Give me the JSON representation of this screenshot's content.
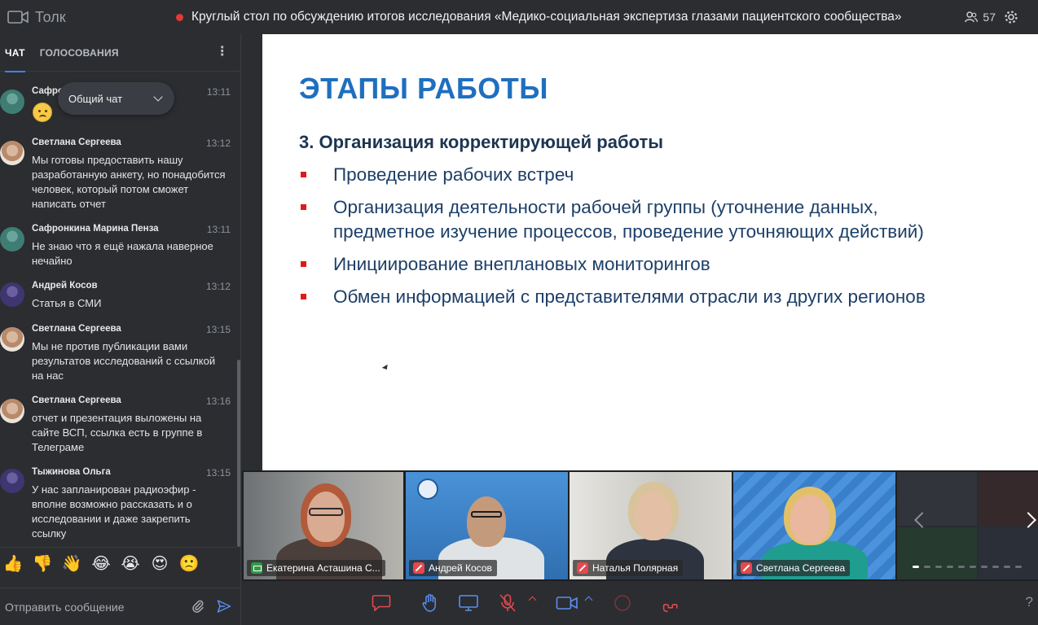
{
  "app": {
    "name": "Толк"
  },
  "meeting": {
    "title": "Круглый стол по обсуждению итогов исследования «Медико-социальная экспертиза глазами пациентского сообщества»",
    "participants_count": "57"
  },
  "chat": {
    "tabs": [
      {
        "label": "ЧАТ",
        "active": true
      },
      {
        "label": "ГОЛОСОВАНИЯ",
        "active": false
      }
    ],
    "selector_value": "Общий чат",
    "messages": [
      {
        "author": "Сафро",
        "time": "13:11",
        "text": "",
        "emoji": "frowning-face"
      },
      {
        "author": "Светлана Сергеева",
        "time": "13:12",
        "text": "Мы готовы предоставить нашу разработанную анкету, но понадобится человек, который потом сможет написать отчет"
      },
      {
        "author": "Сафронкина Марина Пенза",
        "time": "13:11",
        "text": "Не знаю что я ещё нажала наверное нечайно"
      },
      {
        "author": "Андрей Косов",
        "time": "13:12",
        "text": "Статья в СМИ"
      },
      {
        "author": "Светлана Сергеева",
        "time": "13:15",
        "text": "Мы не против публикации вами результатов исследований с ссылкой на нас"
      },
      {
        "author": "Светлана Сергеева",
        "time": "13:16",
        "text": "отчет и презентация выложены на сайте ВСП, ссылка есть в группе в Телеграме"
      },
      {
        "author": "Тыжинова Ольга",
        "time": "13:15",
        "text": "У нас запланирован радиоэфир - вполне возможно рассказать и о исследовании и даже закрепить ссылку"
      }
    ],
    "reactions": [
      "👍",
      "👎",
      "👋",
      "😂",
      "😭",
      "😍",
      "🙁"
    ],
    "compose_placeholder": "Отправить сообщение"
  },
  "slide": {
    "title": "ЭТАПЫ РАБОТЫ",
    "subtitle": "3. Организация корректирующей работы",
    "bullets": [
      "Проведение рабочих встреч",
      "Организация деятельности рабочей группы (уточнение данных, предметное изучение процессов, проведение уточняющих действий)",
      "Инициирование внеплановых мониторингов",
      "Обмен информацией с представителями отрасли из других регионов"
    ]
  },
  "video_tiles": [
    {
      "name": "Екатерина Асташина С...",
      "status": "presenting",
      "active": true
    },
    {
      "name": "Андрей Косов",
      "status": "muted"
    },
    {
      "name": "Наталья Полярная",
      "status": "muted"
    },
    {
      "name": "Светлана Сергеева",
      "status": "muted"
    }
  ],
  "colors": {
    "accent": "#2f80ed",
    "slide_title": "#1f6fbf",
    "slide_text": "#1d3f68",
    "bullet": "#e0191b",
    "control_red": "#e5484d"
  },
  "controls": {
    "help_label": "?"
  }
}
